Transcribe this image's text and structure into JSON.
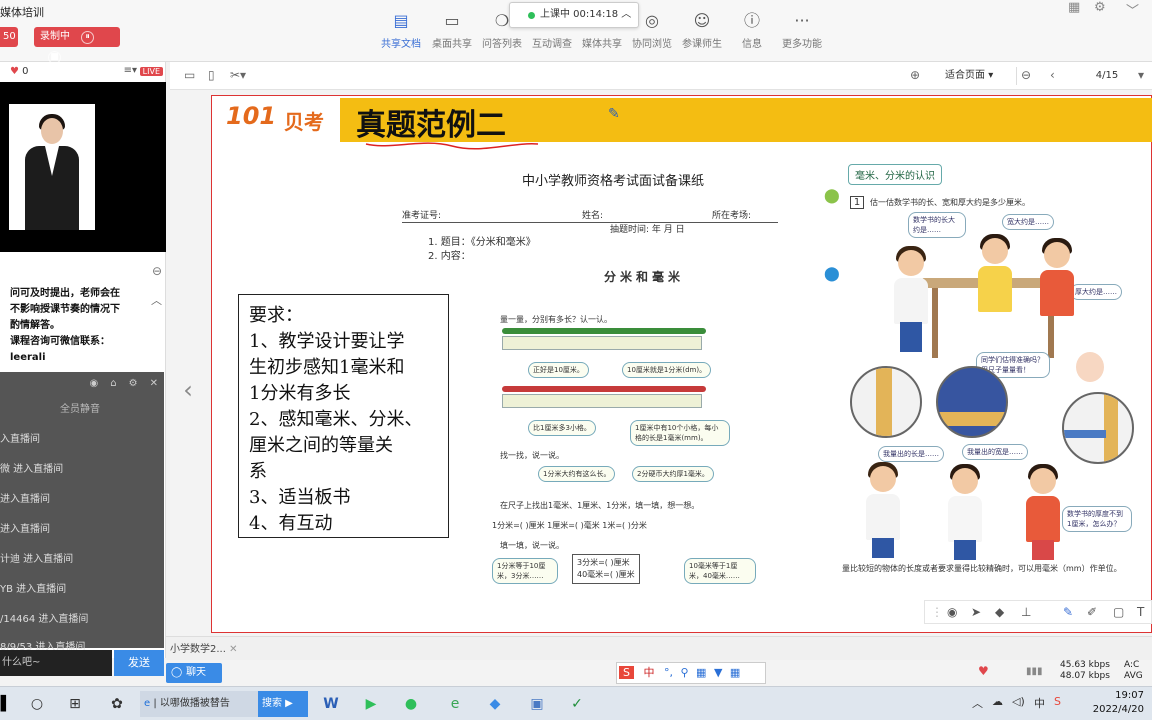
{
  "header": {
    "app_title": "媒体培训",
    "counter": "50",
    "recording_label": "录制中",
    "timer": "上课中 00:14:18",
    "tools": [
      {
        "label": "共享文档",
        "icon": "document-icon"
      },
      {
        "label": "桌面共享",
        "icon": "monitor-icon"
      },
      {
        "label": "问答列表",
        "icon": "chat-bubbles-icon"
      },
      {
        "label": "互动调查",
        "icon": "survey-icon"
      },
      {
        "label": "媒体共享",
        "icon": "media-icon"
      },
      {
        "label": "协同浏览",
        "icon": "compass-icon"
      },
      {
        "label": "参课师生",
        "icon": "people-icon"
      },
      {
        "label": "信息",
        "icon": "info-icon"
      },
      {
        "label": "更多功能",
        "icon": "more-icon"
      }
    ]
  },
  "left_panel": {
    "likes": "0",
    "live_badge": "LIVE",
    "notice_lines": [
      "问可及时提出，老师会在",
      "不影响授课节奏的情况下",
      "酌情解答。",
      "课程咨询可微信联系：",
      "leerali"
    ],
    "chat_entries": [
      "全员静音",
      "入直播间",
      "微 进入直播间",
      "进入直播间",
      "进入直播间",
      "计迪 进入直播间",
      "YB 进入直播间",
      "/14464 进入直播间",
      "8/9/53 进入直播间"
    ],
    "input_placeholder": "什么吧~",
    "send_label": "发送"
  },
  "doc_toolbar": {
    "zoom": "适合页面",
    "page": "4/15"
  },
  "slide": {
    "logo": "101",
    "logo_cn": "贝考",
    "title": "真题范例二",
    "paper_title": "中小学教师资格考试面试备课纸",
    "fields": [
      "准考证号:",
      "姓名:",
      "所在考场:"
    ],
    "draw_time": "抽题时间:    年    月    日",
    "topic_lines": [
      "1. 题目：《分米和毫米》",
      "2. 内容："
    ],
    "lesson_title": "分米和毫米",
    "requirements": [
      "要求：",
      "1、教学设计要让学",
      "生初步感知1毫米和",
      "1分米有多长",
      "2、感知毫米、分米、",
      "厘米之间的等量关",
      "系",
      "3、适当板书",
      "4、有互动"
    ],
    "textbook": {
      "q1": "量一量，分别有多长？认一认。",
      "b1": "正好是10厘米。",
      "b2": "10厘米就是1分米(dm)。",
      "b3": "比1厘米多3小格。",
      "b4": "1厘米中有10个小格，每小格的长是1毫米(mm)。",
      "q2": "找一找，说一说。",
      "b5": "1分米大约有这么长。",
      "b6": "2分硬币大约厚1毫米。",
      "q3": "在尺子上找出1毫米、1厘米、1分米，填一填，想一想。",
      "eq": "1分米=(   )厘米   1厘米=(   )毫米   1米=(   )分米",
      "q4": "填一填，说一说。",
      "x1": "1分米等于10厘米，3分米……",
      "x2": "3分米=(   )厘米",
      "x3": "40毫米=(   )厘米",
      "x4": "10毫米等于1厘米，40毫米……"
    },
    "right_page": {
      "tag": "毫米、分米的认识",
      "q_num": "1",
      "q": "估一估数学书的长、宽和厚大约是多少厘米。",
      "s1": "数学书的长大约是……",
      "s2": "宽大约是……",
      "s3": "厚大约是……",
      "s4": "同学们估得准确吗？用尺子量量看！",
      "s5": "我量出的长是……",
      "s6": "我量出的宽是……",
      "s7": "数学书的厚度不到1厘米，怎么办？",
      "foot": "量比较短的物体的长度或者要求量得比较精确时，可以用毫米（mm）作单位。"
    }
  },
  "bottom": {
    "doc_tab": "小学数学2...",
    "chat_button": "聊天",
    "ime": "中",
    "net_up": "45.63 kbps",
    "net_down": "48.07 kbps",
    "net_label1": "A:C",
    "net_label2": "AVG"
  },
  "taskbar": {
    "window1": "| 以哪做播被替告",
    "window2": "搜索",
    "time": "19:07",
    "date": "2022/4/20",
    "ime": "中"
  },
  "colors": {
    "accent_blue": "#3b6fd4",
    "rec_red": "#e0474c",
    "banner_yellow": "#f4bd12"
  }
}
